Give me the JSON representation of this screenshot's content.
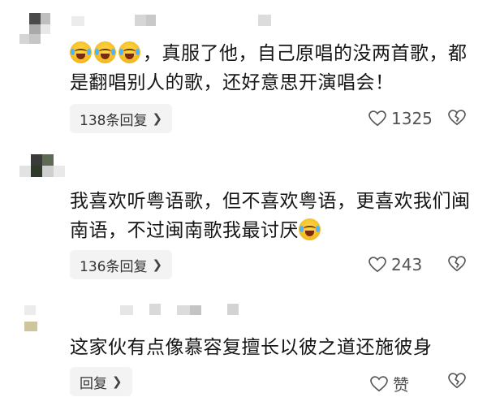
{
  "comments": [
    {
      "emoji_icon": "laughing-crying-emoji",
      "text": "，真服了他，自己原唱的没两首歌，都是翻唱别人的歌，还好意思开演唱会！",
      "reply_label": "138条回复",
      "likes": "1325"
    },
    {
      "text_before": "我喜欢听粤语歌，但不喜欢粤语，更喜欢我们闽南语，不过闽南歌我最讨厌",
      "emoji_icon": "laughing-crying-emoji",
      "reply_label": "136条回复",
      "likes": "243"
    },
    {
      "text": "这家伙有点像慕容复擅长以彼之道还施彼身",
      "reply_label": "回复",
      "likes": "赞"
    }
  ],
  "icons": {
    "like": "heart-outline-icon",
    "dislike": "broken-heart-outline-icon",
    "chevron": "chevron-right-icon"
  },
  "colors": {
    "background": "#ffffff",
    "text": "#161616",
    "pill": "#f3f3f3",
    "meta": "#555555"
  }
}
